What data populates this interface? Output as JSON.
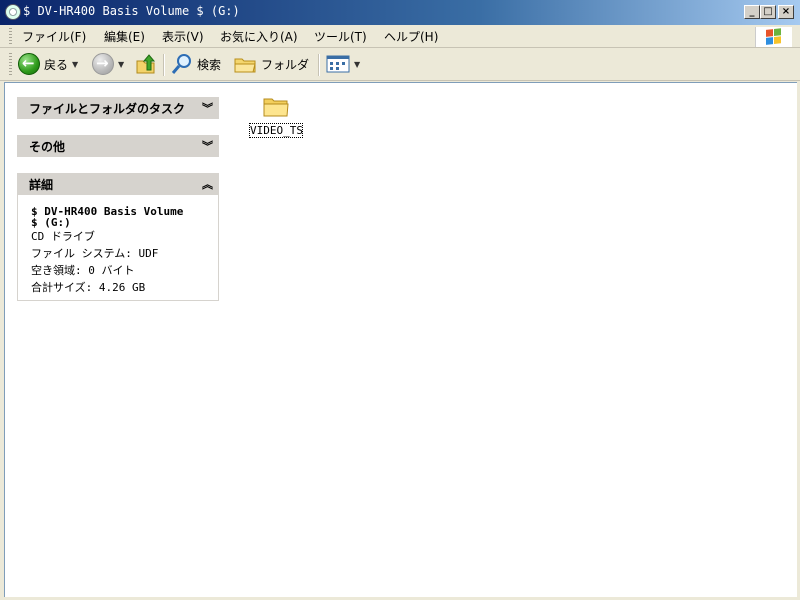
{
  "window": {
    "title": "$ DV-HR400 Basis Volume $ (G:)",
    "title_bar_colors": [
      "#0a246a",
      "#a6caf0"
    ]
  },
  "menubar": {
    "items": [
      "ファイル(F)",
      "編集(E)",
      "表示(V)",
      "お気に入り(A)",
      "ツール(T)",
      "ヘルプ(H)"
    ]
  },
  "toolbar": {
    "back_label": "戻る",
    "search_label": "検索",
    "folders_label": "フォルダ"
  },
  "sidebar": {
    "tasks_title": "ファイルとフォルダのタスク",
    "other_title": "その他",
    "details_title": "詳細",
    "details": {
      "name_line1": "$ DV-HR400 Basis Volume",
      "name_line2": "$ (G:)",
      "type": "CD ドライブ",
      "filesystem": "ファイル システム: UDF",
      "free_space": "空き領域: 0 バイト",
      "total_size": "合計サイズ: 4.26 GB"
    }
  },
  "files": [
    {
      "name": "VIDEO_TS",
      "type": "folder-icon"
    }
  ]
}
